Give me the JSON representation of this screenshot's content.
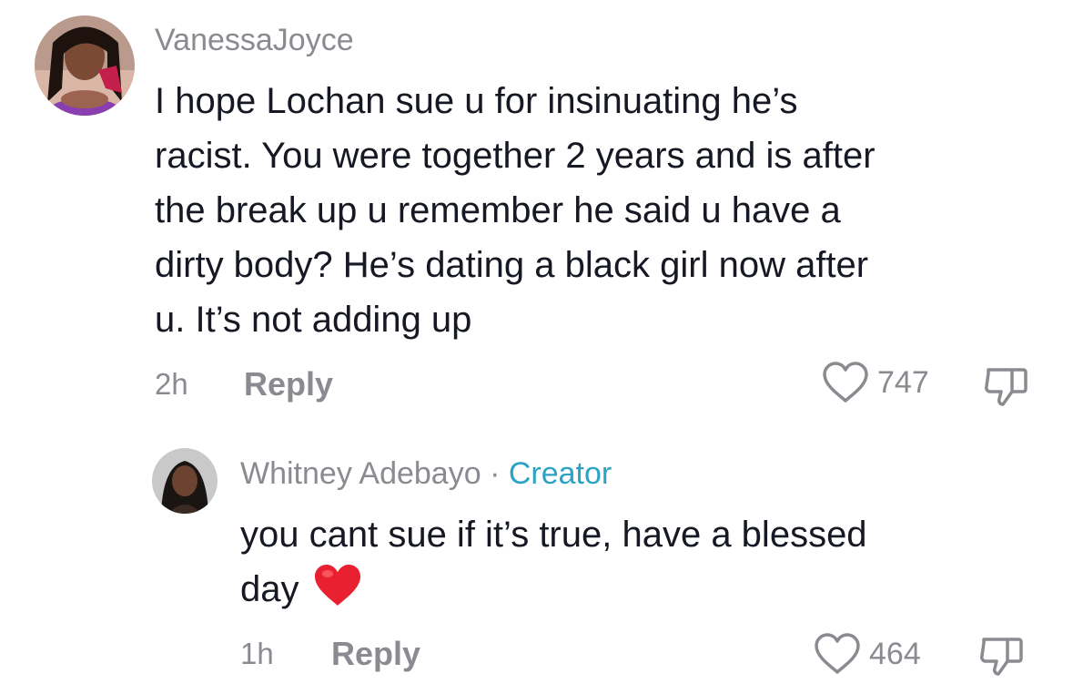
{
  "comments": [
    {
      "username": "VanessaJoyce",
      "lines": [
        "I hope Lochan sue u for insinuating he’s",
        "racist. You were together 2 years and is after",
        "the break up u remember he said u have a",
        "dirty body? He’s dating a black girl now after",
        "u. It’s not adding up"
      ],
      "time": "2h",
      "reply_label": "Reply",
      "likes": "747",
      "avatar_icon": "user-avatar-photo"
    }
  ],
  "reply": {
    "username": "Whitney Adebayo",
    "separator": "·",
    "creator_label": "Creator",
    "lines": [
      "you cant sue if it’s true, have a blessed",
      "day"
    ],
    "emoji": "red-heart-emoji",
    "time": "1h",
    "reply_label": "Reply",
    "likes": "464",
    "avatar_icon": "creator-avatar-photo"
  },
  "colors": {
    "text": "#161823",
    "muted": "#8a8b91",
    "creator": "#2aa3c5",
    "heart": "#e8202f"
  }
}
